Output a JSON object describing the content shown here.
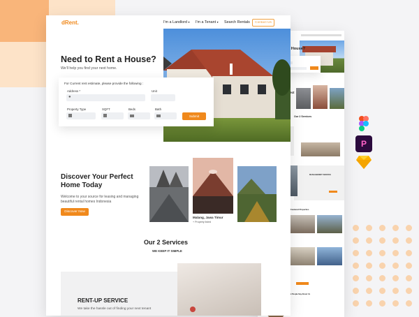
{
  "colors": {
    "accent": "#f0891c",
    "peach": "#fcd7b0",
    "peach_dark": "#f9b57a",
    "dot": "#f8cfa6"
  },
  "brand": {
    "logo": "dRent."
  },
  "nav": {
    "items": [
      "I'm a Landlord",
      "I'm a Tenant",
      "Search Rentals"
    ],
    "contact": "Contact Us"
  },
  "hero": {
    "title": "Need to Rent a House?",
    "subtitle": "We'll help you find your next home.",
    "form": {
      "intro": "For Current rent estimate, please provide the following :",
      "address_label": "Address *",
      "unit_label": "Unit",
      "property_type_label": "Property Type",
      "sqft_label": "SQFT",
      "beds_label": "Beds",
      "bath_label": "Bath",
      "submit": "Submit"
    }
  },
  "discover": {
    "title_line1": "Discover Your Perfect",
    "title_line2": "Home Today",
    "text_line1": "Welcome to your source for leasing and managing",
    "text_line2": "beautiful rental homes Indonesia",
    "button": "Discover Now",
    "caption_place": "Malang, Jawa Timur",
    "caption_sub": "+ Property listed"
  },
  "services": {
    "title": "Our 2 Services",
    "subtitle": "WE KEEP IT SIMPLE",
    "card_title": "RENT-UP SERVICE",
    "card_text": "We take the hassle out of finding your next tenant"
  },
  "mini": {
    "hero_title": "Need to Rent a House?",
    "discover_title_line1": "Discover Your Perfect",
    "discover_title_line2": "Home Today",
    "services_title": "Our 2 Services",
    "rentup": "RENT-UP SERVICE",
    "management": "MANAGEMENT SERVICE",
    "featured": "Featured Properties",
    "testimonials": "What People Say About Us"
  },
  "app_icons": [
    "figma-icon",
    "pixelmator-icon",
    "sketch-icon"
  ]
}
